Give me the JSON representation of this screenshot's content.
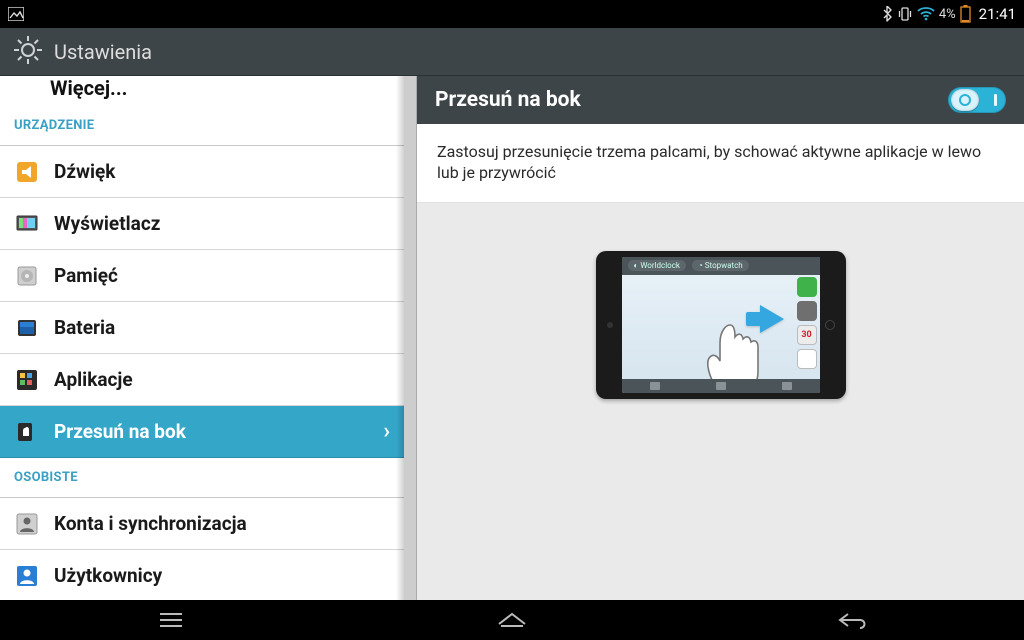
{
  "status": {
    "battery_pct": "4%",
    "time": "21:41"
  },
  "header": {
    "title": "Ustawienia"
  },
  "left": {
    "clipped_row": "Więcej...",
    "section_device": "URZĄDZENIE",
    "rows_device": [
      {
        "label": "Dźwięk"
      },
      {
        "label": "Wyświetlacz"
      },
      {
        "label": "Pamięć"
      },
      {
        "label": "Bateria"
      },
      {
        "label": "Aplikacje"
      },
      {
        "label": "Przesuń na bok"
      }
    ],
    "section_personal": "OSOBISTE",
    "rows_personal": [
      {
        "label": "Konta i synchronizacja"
      },
      {
        "label": "Użytkownicy"
      }
    ]
  },
  "detail": {
    "title": "Przesuń na bok",
    "desc": "Zastosuj przesunięcie trzema palcami, by schować aktywne aplikacje w lewo lub je przywrócić",
    "illus_calendar": "30"
  }
}
